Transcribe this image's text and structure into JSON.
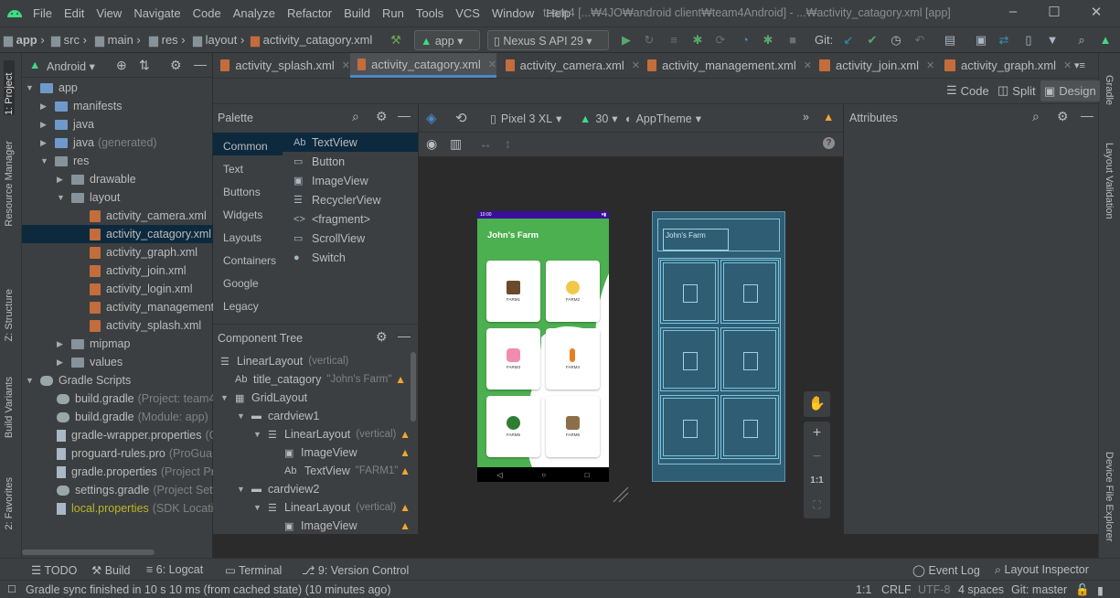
{
  "menu": [
    "File",
    "Edit",
    "View",
    "Navigate",
    "Code",
    "Analyze",
    "Refactor",
    "Build",
    "Run",
    "Tools",
    "VCS",
    "Window",
    "Help"
  ],
  "window_title": "team4 [...₩4JO₩android client₩team4Android] - ...₩activity_catagory.xml [app]",
  "nav": {
    "crumbs": [
      "app",
      "src",
      "main",
      "res",
      "layout",
      "activity_catagory.xml"
    ],
    "run_config": "app",
    "device": "Nexus S API 29",
    "git_label": "Git:"
  },
  "project_panel": {
    "view": "Android"
  },
  "tree": [
    {
      "label": "app",
      "sec": ""
    },
    {
      "label": "manifests",
      "sec": ""
    },
    {
      "label": "java",
      "sec": ""
    },
    {
      "label": "java",
      "sec": "(generated)"
    },
    {
      "label": "res",
      "sec": ""
    },
    {
      "label": "drawable",
      "sec": ""
    },
    {
      "label": "layout",
      "sec": ""
    },
    {
      "label": "activity_camera.xml",
      "sec": ""
    },
    {
      "label": "activity_catagory.xml",
      "sec": ""
    },
    {
      "label": "activity_graph.xml",
      "sec": ""
    },
    {
      "label": "activity_join.xml",
      "sec": ""
    },
    {
      "label": "activity_login.xml",
      "sec": ""
    },
    {
      "label": "activity_management.",
      "sec": ""
    },
    {
      "label": "activity_splash.xml",
      "sec": ""
    },
    {
      "label": "mipmap",
      "sec": ""
    },
    {
      "label": "values",
      "sec": ""
    },
    {
      "label": "Gradle Scripts",
      "sec": ""
    },
    {
      "label": "build.gradle",
      "sec": "(Project: team4)"
    },
    {
      "label": "build.gradle",
      "sec": "(Module: app)"
    },
    {
      "label": "gradle-wrapper.properties",
      "sec": "(G"
    },
    {
      "label": "proguard-rules.pro",
      "sec": "(ProGuar"
    },
    {
      "label": "gradle.properties",
      "sec": "(Project Pro"
    },
    {
      "label": "settings.gradle",
      "sec": "(Project Setti"
    },
    {
      "label": "local.properties",
      "sec": "(SDK Locatio"
    }
  ],
  "tabs": [
    "activity_splash.xml",
    "activity_catagory.xml",
    "activity_camera.xml",
    "activity_management.xml",
    "activity_join.xml",
    "activity_graph.xml"
  ],
  "modes": {
    "code": "Code",
    "split": "Split",
    "design": "Design"
  },
  "palette": {
    "title": "Palette",
    "categories": [
      "Common",
      "Text",
      "Buttons",
      "Widgets",
      "Layouts",
      "Containers",
      "Google",
      "Legacy"
    ],
    "items": [
      {
        "icon": "Ab",
        "label": "TextView"
      },
      {
        "icon": "▭",
        "label": "Button"
      },
      {
        "icon": "▣",
        "label": "ImageView"
      },
      {
        "icon": "☰",
        "label": "RecyclerView"
      },
      {
        "icon": "<>",
        "label": "<fragment>"
      },
      {
        "icon": "▭",
        "label": "ScrollView"
      },
      {
        "icon": "●",
        "label": "Switch"
      }
    ]
  },
  "design_toolbar": {
    "device": "Pixel 3 XL",
    "api": "30",
    "theme": "AppTheme"
  },
  "attributes": {
    "title": "Attributes"
  },
  "component_tree": {
    "title": "Component Tree",
    "items": [
      {
        "label": "LinearLayout",
        "sec": "(vertical)"
      },
      {
        "label": "title_catagory",
        "sec": "\"John's Farm\""
      },
      {
        "label": "GridLayout",
        "sec": ""
      },
      {
        "label": "cardview1",
        "sec": ""
      },
      {
        "label": "LinearLayout",
        "sec": "(vertical)"
      },
      {
        "label": "ImageView",
        "sec": ""
      },
      {
        "label": "TextView",
        "sec": "\"FARM1\""
      },
      {
        "label": "cardview2",
        "sec": ""
      },
      {
        "label": "LinearLayout",
        "sec": "(vertical)"
      },
      {
        "label": "ImageView",
        "sec": ""
      }
    ]
  },
  "phone": {
    "status_time": "10:00",
    "title": "John's Farm",
    "cards": [
      "FARM1",
      "FARM2",
      "FARM3",
      "FARM4",
      "FARM5",
      "FARM6"
    ]
  },
  "blueprint": {
    "title": "John's Farm"
  },
  "zoom": {
    "reset": "1:1"
  },
  "bottom_tabs": [
    "TODO",
    "Build",
    "6: Logcat",
    "Terminal",
    "9: Version Control"
  ],
  "bottom_right": [
    "Event Log",
    "Layout Inspector"
  ],
  "status": {
    "message": "Gradle sync finished in 10 s 10 ms (from cached state) (10 minutes ago)",
    "pos": "1:1",
    "eol": "CRLF",
    "enc": "UTF-8",
    "indent": "4 spaces",
    "git": "Git: master"
  },
  "side_tabs": {
    "left": [
      "1: Project",
      "Resource Manager",
      "Z: Structure",
      "Build Variants",
      "2: Favorites"
    ],
    "right": [
      "Gradle",
      "Layout Validation",
      "Device File Explorer"
    ]
  },
  "colors": {
    "accent": "#4a88c7",
    "phone_green": "#4caf50",
    "status_purple": "#3a0f9a",
    "warning": "#f0a732"
  }
}
